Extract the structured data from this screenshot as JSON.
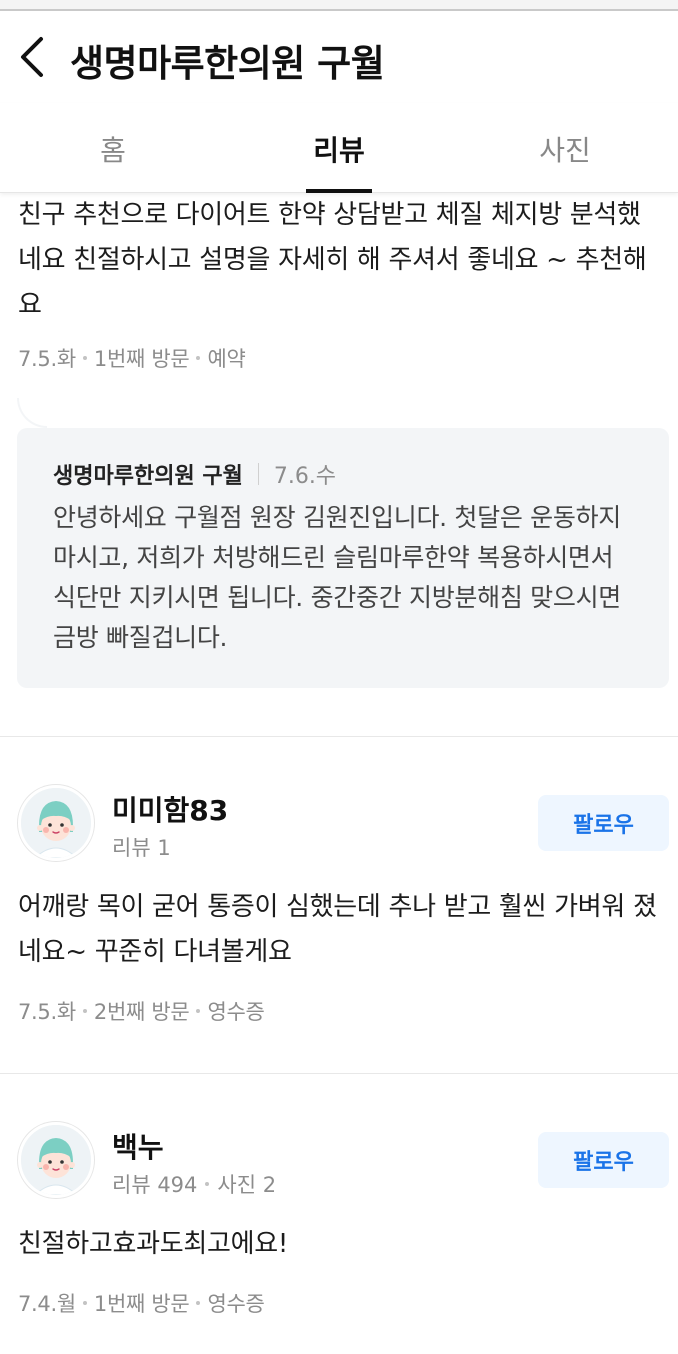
{
  "header": {
    "title": "생명마루한의원 구월"
  },
  "tabs": [
    {
      "label": "홈"
    },
    {
      "label": "리뷰"
    },
    {
      "label": "사진"
    }
  ],
  "reviews": [
    {
      "text": "친구 추천으로 다이어트 한약 상담받고 체질 체지방 분석했네요 친절하시고 설명을 자세히 해 주셔서 좋네요 ~ 추천해요",
      "date": "7.5.화",
      "visit": "1번째 방문",
      "verification": "예약",
      "reply": {
        "name": "생명마루한의원 구월",
        "date": "7.6.수",
        "text": "안녕하세요 구월점 원장 김원진입니다. 첫달은 운동하지마시고, 저희가 처방해드린 슬림마루한약 복용하시면서 식단만 지키시면 됩니다. 중간중간 지방분해침 맞으시면 금방 빠질겁니다."
      }
    },
    {
      "nickname": "미미함83",
      "stats": "리뷰 1",
      "follow_label": "팔로우",
      "text": "어깨랑 목이 굳어 통증이 심했는데 추나 받고 훨씬 가벼워 졌네요~ 꾸준히 다녀볼게요",
      "date": "7.5.화",
      "visit": "2번째 방문",
      "verification": "영수증"
    },
    {
      "nickname": "백누",
      "stats": "리뷰 494",
      "photos": "사진 2",
      "follow_label": "팔로우",
      "text": "친절하고효과도최고에요!",
      "date": "7.4.월",
      "visit": "1번째 방문",
      "verification": "영수증"
    }
  ],
  "colors": {
    "follow_text": "#1a73e8",
    "follow_bg": "#eef6ff",
    "reply_bg": "#f3f5f7"
  },
  "icons": {
    "back": "chevron-left-icon",
    "avatar": "user-avatar-illustration"
  }
}
